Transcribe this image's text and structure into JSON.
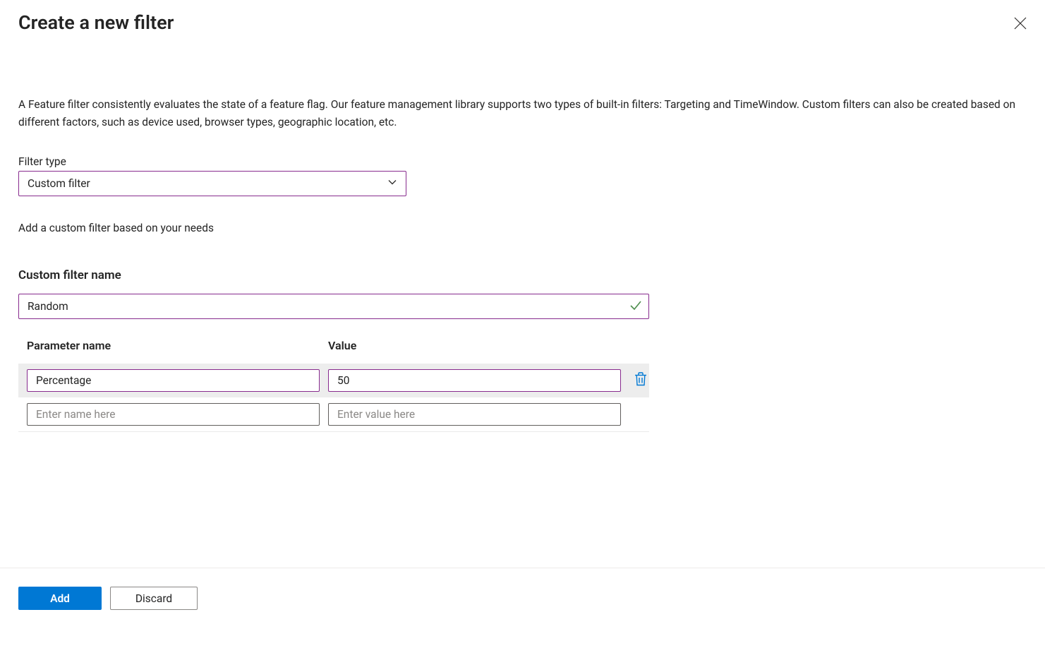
{
  "header": {
    "title": "Create a new filter"
  },
  "description": "A Feature filter consistently evaluates the state of a feature flag. Our feature management library supports two types of built-in filters: Targeting and TimeWindow. Custom filters can also be created based on different factors, such as device used, browser types, geographic location, etc.",
  "filterType": {
    "label": "Filter type",
    "value": "Custom filter"
  },
  "helperText": "Add a custom filter based on your needs",
  "customFilter": {
    "sectionTitle": "Custom filter name",
    "nameValue": "Random"
  },
  "paramTable": {
    "header": {
      "name": "Parameter name",
      "value": "Value"
    },
    "rows": [
      {
        "name": "Percentage",
        "value": "50"
      }
    ],
    "placeholders": {
      "name": "Enter name here",
      "value": "Enter value here"
    }
  },
  "footer": {
    "add": "Add",
    "discard": "Discard"
  }
}
